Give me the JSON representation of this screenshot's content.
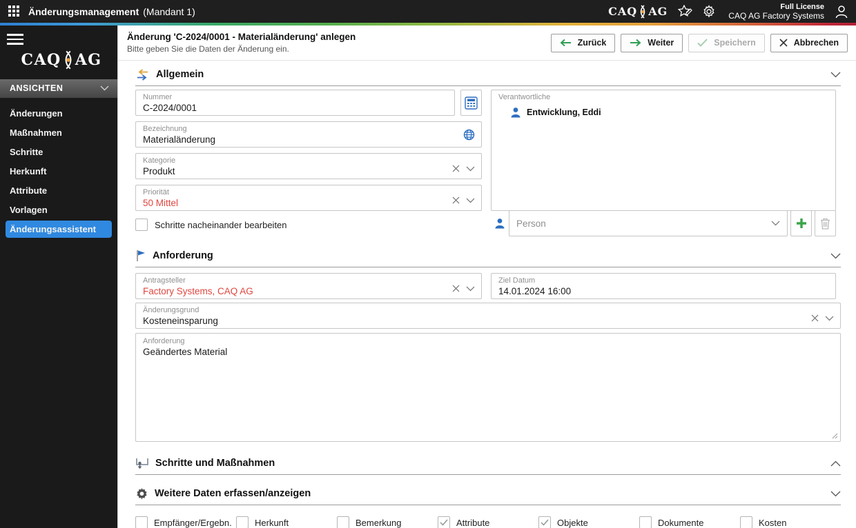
{
  "topbar": {
    "title": "Änderungsmanagement",
    "client": "(Mandant 1)",
    "logo_caq": "CAQ",
    "logo_ag": "AG",
    "license_line1": "Full License",
    "license_line2": "CAQ AG Factory Systems"
  },
  "sidebar": {
    "section_label": "ANSICHTEN",
    "items": [
      {
        "label": "Änderungen",
        "active": false
      },
      {
        "label": "Maßnahmen",
        "active": false
      },
      {
        "label": "Schritte",
        "active": false
      },
      {
        "label": "Herkunft",
        "active": false
      },
      {
        "label": "Attribute",
        "active": false
      },
      {
        "label": "Vorlagen",
        "active": false
      },
      {
        "label": "Änderungsassistent",
        "active": true
      }
    ]
  },
  "header": {
    "title": "Änderung 'C-2024/0001 - Materialänderung' anlegen",
    "subtitle": "Bitte geben Sie die Daten der Änderung ein.",
    "buttons": {
      "back": {
        "label": "Zurück"
      },
      "next": {
        "label": "Weiter"
      },
      "save": {
        "label": "Speichern",
        "disabled": true
      },
      "cancel": {
        "label": "Abbrechen"
      }
    }
  },
  "sections": {
    "allgemein": "Allgemein",
    "anforderung": "Anforderung",
    "schritte": "Schritte und Maßnahmen",
    "weitere": "Weitere Daten erfassen/anzeigen"
  },
  "fields": {
    "nummer": {
      "label": "Nummer",
      "value": "C-2024/0001"
    },
    "bezeichnung": {
      "label": "Bezeichnung",
      "value": "Materialänderung"
    },
    "kategorie": {
      "label": "Kategorie",
      "value": "Produkt"
    },
    "prioritaet": {
      "label": "Priorität",
      "value": "50 Mittel"
    },
    "schritte_checkbox": {
      "label": "Schritte nacheinander bearbeiten",
      "checked": false
    },
    "verantwortliche": {
      "label": "Verantwortliche",
      "person": "Entwicklung, Eddi"
    },
    "person_placeholder": "Person",
    "antragsteller": {
      "label": "Antragsteller",
      "value": "Factory Systems, CAQ AG"
    },
    "ziel_datum": {
      "label": "Ziel Datum",
      "value": "14.01.2024 16:00"
    },
    "aenderungsgrund": {
      "label": "Änderungsgrund",
      "value": "Kosteneinsparung"
    },
    "anforderung_text": {
      "label": "Anforderung",
      "value": "Geändertes Material"
    }
  },
  "bottom_checkboxes": [
    {
      "label": "Empfänger/Ergebn.",
      "checked": false
    },
    {
      "label": "Herkunft",
      "checked": false
    },
    {
      "label": "Bemerkung",
      "checked": false
    },
    {
      "label": "Attribute",
      "checked": true
    },
    {
      "label": "Objekte",
      "checked": true
    },
    {
      "label": "Dokumente",
      "checked": false
    },
    {
      "label": "Kosten",
      "checked": false
    }
  ],
  "colors": {
    "active_blue": "#2f89e0",
    "alert_red": "#e0463f",
    "action_green": "#2f9e54",
    "icon_blue": "#2d6fc0",
    "brand_orange_dot": "#e8a33c"
  }
}
